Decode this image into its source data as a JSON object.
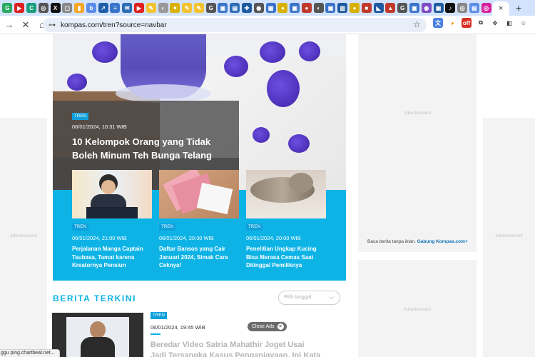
{
  "browser": {
    "url": "kompas.com/tren?source=navbar",
    "status_text": "ggu ping.chartbeat.net...",
    "new_tab_symbol": "+",
    "close_tab_symbol": "×"
  },
  "ads": {
    "advertisement_label": "Advertisement",
    "promo_text": "Baca berita tanpa iklan.",
    "promo_link": "Gabung Kompas.com+"
  },
  "hero": {
    "tag": "TREN",
    "date": "06/01/2024, 10:31 WIB",
    "title": "10 Kelompok Orang yang Tidak Boleh Minum Teh Bunga Telang"
  },
  "cards": [
    {
      "tag": "TREN",
      "date": "06/01/2024, 21:00 WIB",
      "title": "Perjalanan Manga Captain Tsubasa, Tamat karena Kreatornya Pensiun"
    },
    {
      "tag": "TREN",
      "date": "06/01/2024, 20:30 WIB",
      "title": "Daftar Bansos yang Cair Januari 2024, Simak Cara Ceknya!"
    },
    {
      "tag": "TREN",
      "date": "06/01/2024, 20:00 WIB",
      "title": "Penelitian Ungkap Kucing Bisa Merasa Cemas Saat Ditinggal Pemiliknya"
    }
  ],
  "latest": {
    "section_title": "BERITA TERKINI",
    "date_placeholder": "Pilih tanggal",
    "item": {
      "tag": "TREN",
      "date": "06/01/2024, 19:45 WIB",
      "title": "Beredar Video Satria Mahathir Joget Usai Jadi Tersangka Kasus Penganiayaan, Ini Kata Polisi"
    },
    "close_ads_label": "Close Ads"
  },
  "colors": {
    "accent": "#0eb3e6",
    "tab_bar": "#d3e3fd"
  }
}
